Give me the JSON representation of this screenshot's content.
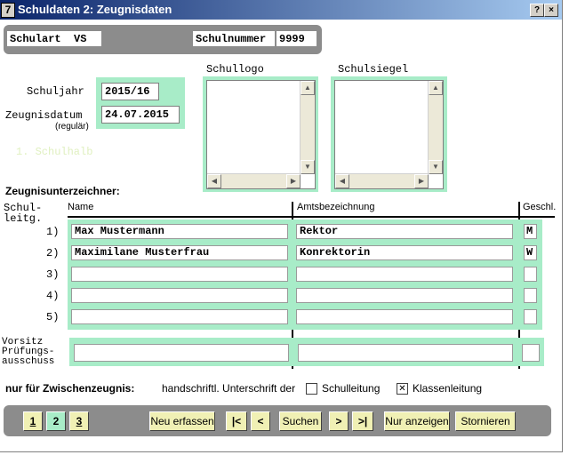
{
  "window": {
    "title": "Schuldaten 2: Zeugnisdaten",
    "app_icon": "7",
    "help_button": "?",
    "close_button": "×"
  },
  "header": {
    "schulart_label": "Schulart",
    "schulart_value": "VS",
    "schulnummer_label": "Schulnummer",
    "schulnummer_value": "9999"
  },
  "dates": {
    "schuljahr_label": "Schuljahr",
    "schuljahr_value": "2015/16",
    "zeugnisdatum_label": "Zeugnisdatum",
    "zeugnisdatum_sublabel": "(regulär)",
    "zeugnisdatum_value": "24.07.2015",
    "faded_text": "1. Schulhalb"
  },
  "images": {
    "schullogo_label": "Schullogo",
    "schulsiegel_label": "Schulsiegel"
  },
  "signers": {
    "section_title": "Zeugnisunterzeichner:",
    "side_label": "Schul-\nleitg.",
    "col_name": "Name",
    "col_amt": "Amtsbezeichnung",
    "col_geschl": "Geschl.",
    "rows": [
      {
        "num": "1)",
        "name": "Max Mustermann",
        "amt": "Rektor",
        "geschl": "M"
      },
      {
        "num": "2)",
        "name": "Maximilane Musterfrau",
        "amt": "Konrektorin",
        "geschl": "W"
      },
      {
        "num": "3)",
        "name": "",
        "amt": "",
        "geschl": ""
      },
      {
        "num": "4)",
        "name": "",
        "amt": "",
        "geschl": ""
      },
      {
        "num": "5)",
        "name": "",
        "amt": "",
        "geschl": ""
      }
    ],
    "vorsitz_label": "Vorsitz\nPrüfungs-\nausschuss",
    "vorsitz_name": "",
    "vorsitz_amt": "",
    "vorsitz_geschl": ""
  },
  "zwischen": {
    "title": "nur für Zwischenzeugnis:",
    "hint": "handschriftl. Unterschrift der",
    "schulleitung_label": "Schulleitung",
    "schulleitung_checked": false,
    "klassenleitung_label": "Klassenleitung",
    "klassenleitung_checked": true
  },
  "nav": {
    "page1": "1",
    "page2": "2",
    "page3": "3",
    "neu": "Neu erfassen",
    "first": "|<",
    "prev": "<",
    "suchen": "Suchen",
    "next": ">",
    "last": ">|",
    "nur_anzeigen": "Nur anzeigen",
    "stornieren": "Stornieren"
  }
}
